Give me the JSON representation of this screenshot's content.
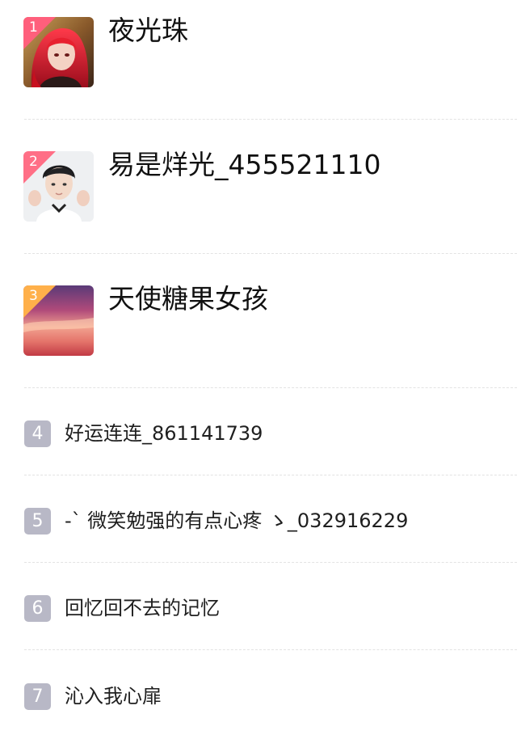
{
  "ranking": {
    "items": [
      {
        "rank": "1",
        "name": "夜光珠",
        "avatar": "avatar-red-hair-character"
      },
      {
        "rank": "2",
        "name": "易是烊光_455521110",
        "avatar": "avatar-young-man"
      },
      {
        "rank": "3",
        "name": "天使糖果女孩",
        "avatar": "avatar-sunset-sky"
      },
      {
        "rank": "4",
        "name": "好运连连_861141739"
      },
      {
        "rank": "5",
        "name": "-ˋ 微笑勉强的有点心疼 ゝ_032916229"
      },
      {
        "rank": "6",
        "name": "回忆回不去的记忆"
      },
      {
        "rank": "7",
        "name": "沁入我心扉"
      }
    ]
  },
  "colors": {
    "rank1_badge": "#ff5f7c",
    "rank2_badge": "#ff6f86",
    "rank3_badge": "#ffb04a",
    "rank_box": "#b8b8c6",
    "divider": "#e3e3e3"
  }
}
